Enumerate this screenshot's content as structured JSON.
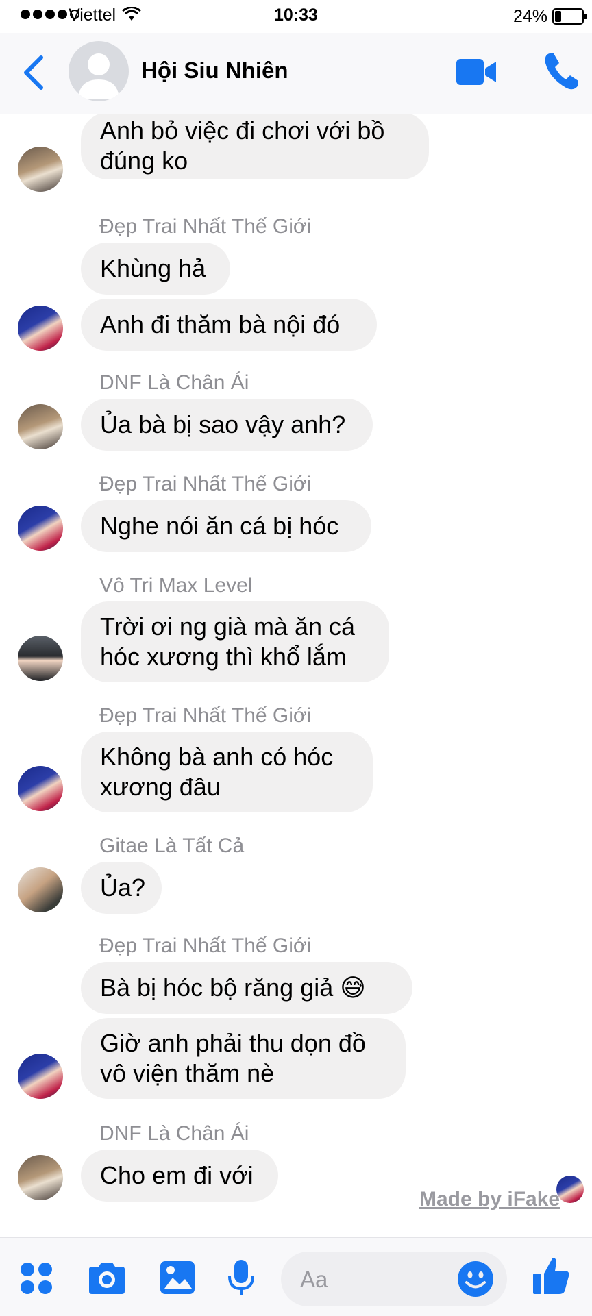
{
  "status_bar": {
    "carrier": "Viettel",
    "time": "10:33",
    "battery": "24%"
  },
  "header": {
    "title": "Hội Siu Nhiên",
    "back_icon": "back-chevron-icon",
    "video_icon": "video-camera-icon",
    "call_icon": "phone-icon"
  },
  "messages": [
    {
      "sender": "",
      "text": "Anh bỏ việc đi chơi với bồ\nđúng ko"
    },
    {
      "sender": "Đẹp Trai Nhất Thế Giới",
      "text": "Khùng hả"
    },
    {
      "sender": "",
      "text": "Anh đi thăm bà nội đó"
    },
    {
      "sender": "DNF Là Chân Ái",
      "text": "Ủa bà bị sao vậy anh?"
    },
    {
      "sender": "Đẹp Trai Nhất Thế Giới",
      "text": "Nghe nói ăn cá bị hóc"
    },
    {
      "sender": "Vô Tri Max Level",
      "text": "Trời ơi ng già mà ăn cá\nhóc xương thì khổ lắm"
    },
    {
      "sender": "Đẹp Trai Nhất Thế Giới",
      "text": "Không bà anh có hóc\nxương đâu"
    },
    {
      "sender": "Gitae Là Tất Cả",
      "text": "Ủa?"
    },
    {
      "sender": "Đẹp Trai Nhất Thế Giới",
      "text": "Bà bị hóc bộ răng giả 😅"
    },
    {
      "sender": "",
      "text": "Giờ anh phải thu dọn đồ\nvô viện thăm nè"
    },
    {
      "sender": "DNF Là Chân Ái",
      "text": "Cho em đi với"
    }
  ],
  "watermark": "Made by iFake",
  "composer": {
    "placeholder": "Aa"
  },
  "colors": {
    "accent": "#1877f2",
    "bubble": "#f1f0f0",
    "sender_name": "#8e8e93"
  }
}
